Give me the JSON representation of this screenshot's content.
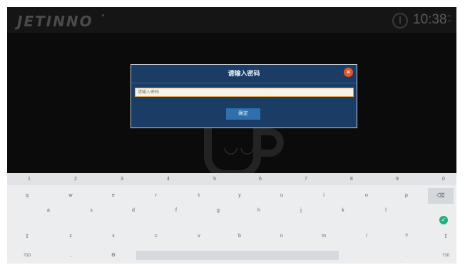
{
  "header": {
    "logo_text": "JETINNO",
    "clock": "10:38"
  },
  "dialog": {
    "title": "请输入密码",
    "input_placeholder": "请输入密码",
    "confirm_label": "确定",
    "close_icon": "close-icon"
  },
  "keyboard": {
    "number_row": [
      "1",
      "2",
      "3",
      "4",
      "5",
      "6",
      "7",
      "8",
      "9",
      "0"
    ],
    "row1": [
      "q",
      "w",
      "e",
      "r",
      "t",
      "y",
      "u",
      "i",
      "o",
      "p"
    ],
    "row2": [
      "a",
      "s",
      "d",
      "f",
      "g",
      "h",
      "j",
      "k",
      "l"
    ],
    "row3": [
      "z",
      "x",
      "c",
      "v",
      "b",
      "n",
      "m",
      "!",
      "?"
    ],
    "symbols_label": "?10",
    "comma": ",",
    "settings_symbol": "⚙",
    "shift_symbol": "⇧",
    "backspace_symbol": "⌫",
    "enter_symbol": "✓",
    "period": "."
  },
  "colors": {
    "dialog_bg": "#1b3c64",
    "close_button": "#e2572c",
    "confirm_button": "#2f6fae",
    "enter_key": "#22b07d"
  }
}
